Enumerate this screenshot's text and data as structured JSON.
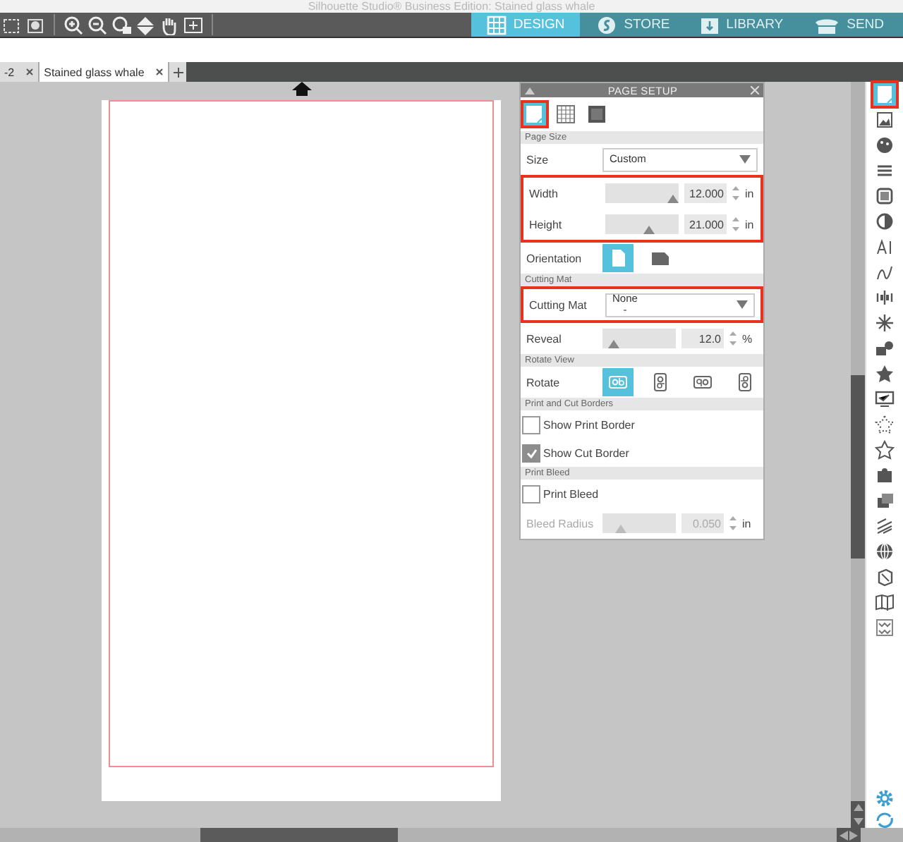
{
  "window": {
    "title": "Silhouette Studio® Business Edition: Stained glass whale"
  },
  "main_tabs": [
    {
      "label": "DESIGN",
      "selected": true
    },
    {
      "label": "STORE",
      "selected": false
    },
    {
      "label": "LIBRARY",
      "selected": false
    },
    {
      "label": "SEND",
      "selected": false
    }
  ],
  "doc_tabs": [
    {
      "label": "-2",
      "selected": false
    },
    {
      "label": "Stained glass whale",
      "selected": true
    }
  ],
  "panel": {
    "title": "PAGE SETUP",
    "view_tabs": [
      {
        "selected": true,
        "highlighted": true
      },
      {
        "selected": false,
        "highlighted": false
      },
      {
        "selected": false,
        "highlighted": false
      }
    ],
    "sections": [
      {
        "title": "Page Size",
        "rows": [
          {
            "kind": "select",
            "label": "Size",
            "value": "Custom",
            "highlighted": false
          },
          {
            "kind": "slider",
            "label": "Width",
            "level": 1.0,
            "value": "12.000",
            "unit": "in",
            "disabled": false,
            "highlighted": true
          },
          {
            "kind": "slider",
            "label": "Height",
            "level": 0.6,
            "value": "21.000",
            "unit": "in",
            "disabled": false,
            "highlighted": true
          },
          {
            "kind": "options",
            "label": "Orientation",
            "options": [
              {
                "selected": true
              },
              {
                "selected": false
              }
            ],
            "highlighted": false
          }
        ]
      },
      {
        "title": "Cutting Mat",
        "rows": [
          {
            "kind": "select",
            "label": "Cutting Mat",
            "value": "None",
            "detail": "-",
            "highlighted": true
          },
          {
            "kind": "slider",
            "label": "Reveal",
            "level": 0.15,
            "value": "12.0",
            "unit": "%",
            "disabled": false,
            "highlighted": false
          }
        ]
      },
      {
        "title": "Rotate View",
        "rows": [
          {
            "kind": "options",
            "label": "Rotate",
            "options": [
              {
                "selected": true
              },
              {
                "selected": false
              },
              {
                "selected": false
              },
              {
                "selected": false
              }
            ],
            "highlighted": false
          }
        ]
      },
      {
        "title": "Print and Cut Borders",
        "rows": [
          {
            "kind": "checkbox",
            "label": "Show Print Border",
            "checked": false,
            "highlighted": false
          },
          {
            "kind": "checkbox",
            "label": "Show Cut Border",
            "checked": true,
            "highlighted": false
          }
        ]
      },
      {
        "title": "Print Bleed",
        "rows": [
          {
            "kind": "checkbox",
            "label": "Print Bleed",
            "checked": false,
            "highlighted": false
          },
          {
            "kind": "slider",
            "label": "Bleed Radius",
            "level": 0.25,
            "value": "0.050",
            "unit": "in",
            "disabled": true,
            "highlighted": false
          }
        ]
      }
    ]
  },
  "sidebar": [
    {
      "selected": true,
      "highlighted": true
    },
    {
      "selected": false,
      "highlighted": false
    },
    {
      "selected": false,
      "highlighted": false
    },
    {
      "selected": false,
      "highlighted": false
    },
    {
      "selected": false,
      "highlighted": false
    },
    {
      "selected": false,
      "highlighted": false
    },
    {
      "selected": false,
      "highlighted": false
    },
    {
      "selected": false,
      "highlighted": false
    },
    {
      "selected": false,
      "highlighted": false
    },
    {
      "selected": false,
      "highlighted": false
    },
    {
      "selected": false,
      "highlighted": false
    },
    {
      "selected": false,
      "highlighted": false
    },
    {
      "selected": false,
      "highlighted": false
    },
    {
      "selected": false,
      "highlighted": false
    },
    {
      "selected": false,
      "highlighted": false
    },
    {
      "selected": false,
      "highlighted": false
    },
    {
      "selected": false,
      "highlighted": false
    },
    {
      "selected": false,
      "highlighted": false
    },
    {
      "selected": false,
      "highlighted": false
    },
    {
      "selected": false,
      "highlighted": false
    },
    {
      "selected": false,
      "highlighted": false
    },
    {
      "selected": false,
      "highlighted": false
    }
  ]
}
